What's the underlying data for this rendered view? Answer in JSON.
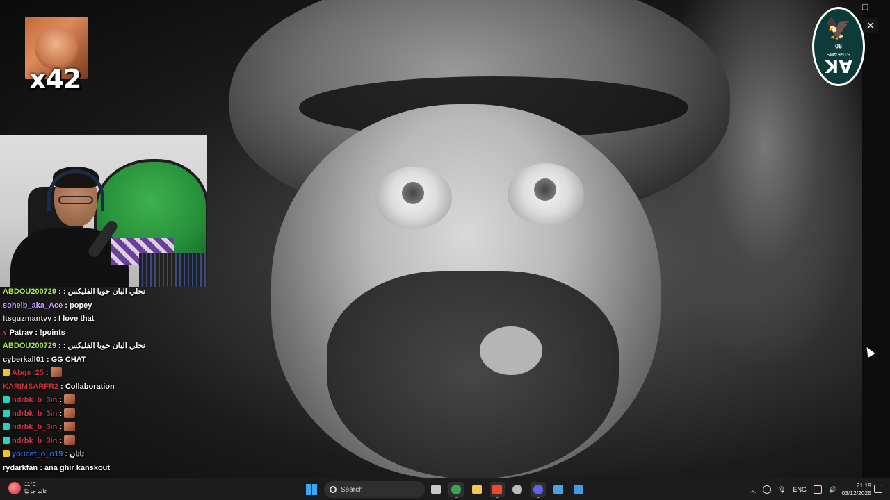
{
  "overlay": {
    "emote_counter": "x42",
    "logo_monogram": "AK",
    "logo_subtitle": "STREAMS",
    "logo_code": "90"
  },
  "chat": {
    "messages": [
      {
        "user": "ABDOU200729",
        "text": ": نحلي البان خويا الفليكس",
        "color": "#a6e94f",
        "badge": null,
        "emote": false
      },
      {
        "user": "soheib_aka_Ace",
        "text": "popey",
        "color": "#c8a2ff",
        "badge": null,
        "emote": false
      },
      {
        "user": "Itsguzmantvv",
        "text": "I love that",
        "color": "#d8d8d8",
        "badge": null,
        "emote": false
      },
      {
        "user": "Patrav",
        "text": "!points",
        "color": "#ffffff",
        "badge": "heart",
        "emote": false
      },
      {
        "user": "ABDOU200729",
        "text": ": نحلي البان خويا الفليكس",
        "color": "#a6e94f",
        "badge": null,
        "emote": false
      },
      {
        "user": "cyberkall01",
        "text": "GG CHAT",
        "color": "#e6e6e6",
        "badge": null,
        "emote": false
      },
      {
        "user": "Abgs_25",
        "text": "",
        "color": "#c9363c",
        "badge": "sub",
        "emote": true
      },
      {
        "user": "KARIMSARFR2",
        "text": "Collaboration",
        "color": "#c9363c",
        "badge": null,
        "emote": false
      },
      {
        "user": "ndrbk_b_3in",
        "text": "",
        "color": "#d8334a",
        "badge": "mod",
        "emote": true
      },
      {
        "user": "ndrbk_b_3in",
        "text": "",
        "color": "#d8334a",
        "badge": "mod",
        "emote": true
      },
      {
        "user": "ndrbk_b_3in",
        "text": "",
        "color": "#d8334a",
        "badge": "mod",
        "emote": true
      },
      {
        "user": "ndrbk_b_3in",
        "text": "",
        "color": "#d8334a",
        "badge": "mod",
        "emote": true
      },
      {
        "user": "youcef_o_o19",
        "text": "تاتان",
        "color": "#3a6ae0",
        "badge": "sub",
        "emote": false
      },
      {
        "user": "rydarkfan",
        "text": "ana ghir kanskout",
        "color": "#ffffff",
        "badge": null,
        "emote": false
      }
    ]
  },
  "taskbar": {
    "weather_temp": "11°C",
    "weather_desc": "غائم جزئيًا",
    "search_label": "Search",
    "language": "ENG",
    "time": "21:19",
    "date": "03/12/2025",
    "apps": [
      {
        "name": "task-view-icon",
        "color": "#c8c8c8",
        "active": false
      },
      {
        "name": "chrome-icon",
        "color": "#34a853",
        "active": true
      },
      {
        "name": "file-explorer-icon",
        "color": "#f2c94c",
        "active": false
      },
      {
        "name": "brave-icon",
        "color": "#ef4b2b",
        "active": true
      },
      {
        "name": "obs-icon",
        "color": "#bcbcbc",
        "active": false
      },
      {
        "name": "discord-icon",
        "color": "#5865f2",
        "active": true
      },
      {
        "name": "photos-icon",
        "color": "#4aa3df",
        "active": false
      },
      {
        "name": "snipping-tool-icon",
        "color": "#3aa0e0",
        "active": false
      }
    ]
  },
  "colors": {
    "taskbar_bg": "#1c1c1c",
    "windows_blue": "#38a7f5"
  }
}
